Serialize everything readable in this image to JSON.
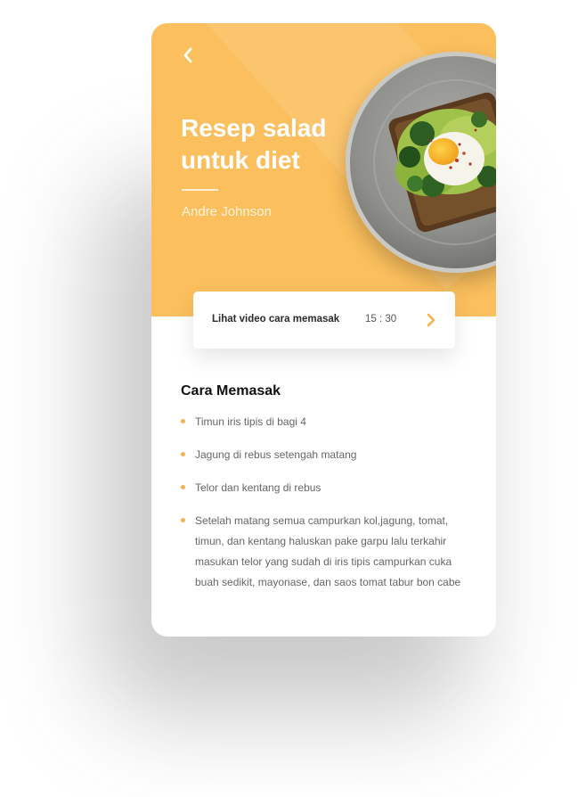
{
  "hero": {
    "back_icon": "chevron-left-icon",
    "title": "Resep salad\nuntuk diet",
    "author": "Andre Johnson",
    "photo_description_icon": "plate-photo"
  },
  "video": {
    "label": "Lihat video cara memasak",
    "duration": "15 : 30",
    "chevron_icon": "chevron-right-icon"
  },
  "steps_section": {
    "title": "Cara Memasak",
    "items": [
      "Timun iris tipis di bagi 4",
      "Jagung di rebus setengah matang",
      "Telor dan kentang di rebus",
      "Setelah matang semua campurkan kol,jagung, tomat, timun, dan kentang haluskan pake garpu lalu terkahir masukan telor yang sudah di iris tipis campurkan cuka buah sedikit, mayonase, dan saos tomat tabur bon cabe"
    ]
  },
  "colors": {
    "accent": "#fbbf5d",
    "bullet": "#f8b04a",
    "card": "#ffffff"
  }
}
